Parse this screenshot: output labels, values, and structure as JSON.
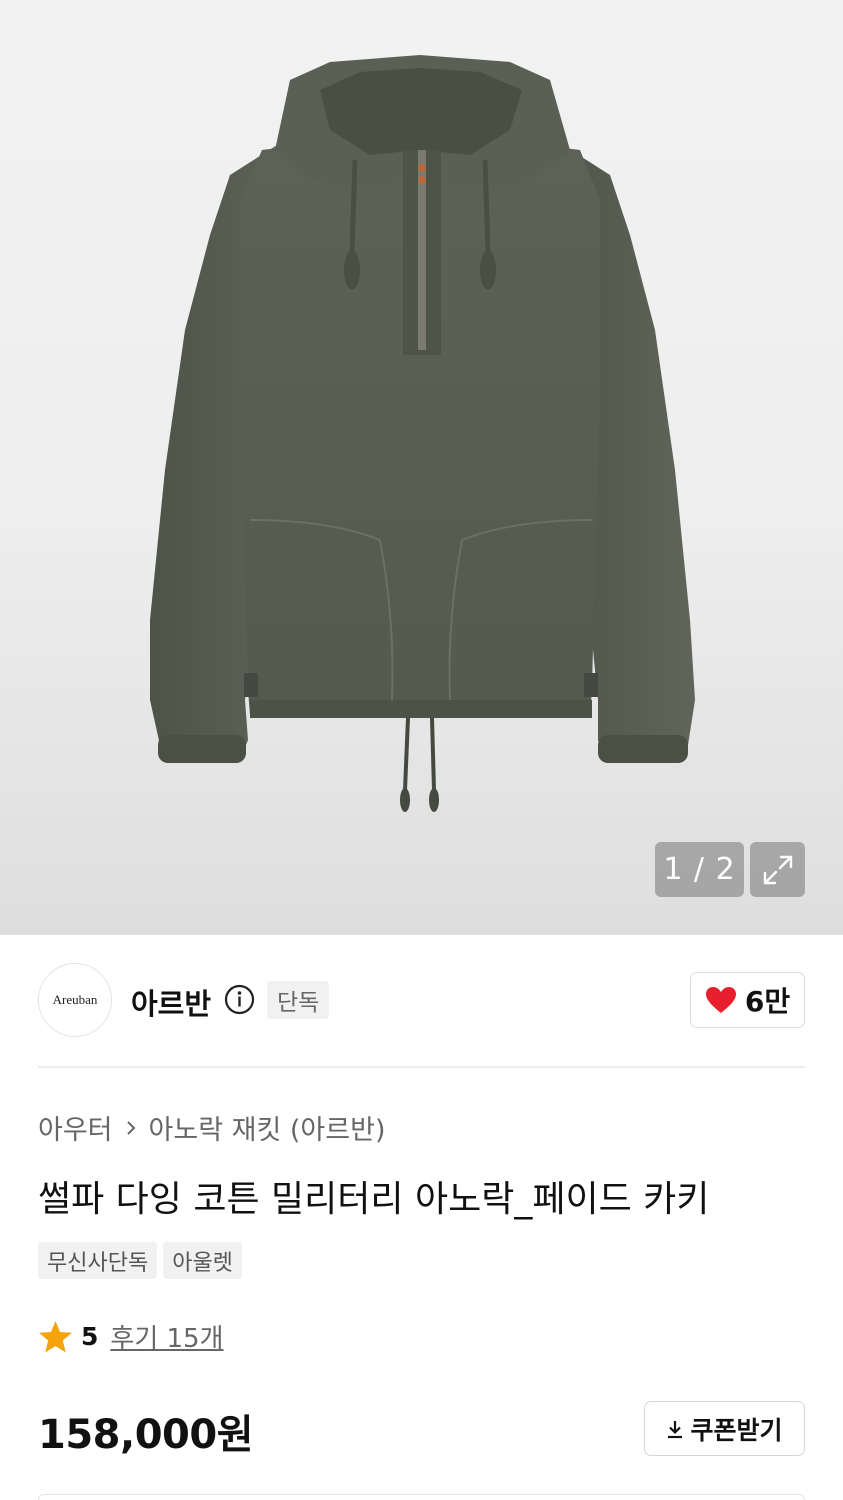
{
  "gallery": {
    "counter": "1 / 2",
    "image_icon": "jacket-photo",
    "expand_icon": "expand-icon"
  },
  "brand": {
    "logo_text": "Areuban",
    "name": "아르반",
    "info_icon": "info-icon",
    "badge": "단독"
  },
  "like": {
    "icon": "heart-icon",
    "count": "6만",
    "heart_color": "#e8202e"
  },
  "breadcrumb": {
    "category": "아우터",
    "separator_icon": "chevron-right-icon",
    "subcategory": "아노락 재킷 (아르반)"
  },
  "product": {
    "title": "썰파 다잉 코튼 밀리터리 아노락_페이드 카키",
    "tags": [
      "무신사단독",
      "아울렛"
    ]
  },
  "rating": {
    "star_icon": "star-icon",
    "star_color": "#f5a30a",
    "score": "5",
    "reviews_label": "후기 15개"
  },
  "price": {
    "amount": "158,000원"
  },
  "coupon": {
    "icon": "download-icon",
    "label": "쿠폰받기"
  }
}
